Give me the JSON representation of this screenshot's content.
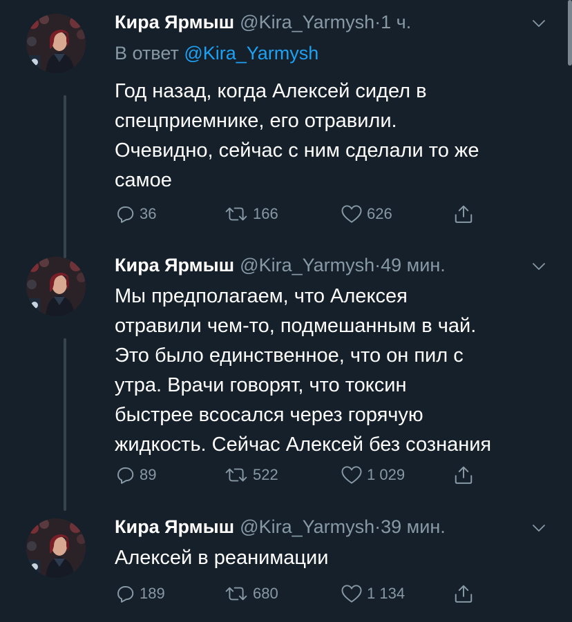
{
  "colors": {
    "background": "#15202b",
    "text": "#ffffff",
    "secondary": "#8899a6",
    "accent": "#1da1f2",
    "thread_line": "#38444d"
  },
  "icons": {
    "reply": "reply-icon",
    "retweet": "retweet-icon",
    "like": "heart-icon",
    "share": "share-icon",
    "menu": "chevron-down-icon"
  },
  "tweets": [
    {
      "name": "Кира Ярмыш",
      "handle": "@Kira_Yarmysh",
      "dot": "·",
      "time": "1 ч.",
      "reply_label": "В ответ",
      "reply_mention": "@Kira_Yarmysh",
      "text": "Год назад, когда Алексей сидел в\nспецприемнике, его отравили.\nОчевидно, сейчас с ним сделали то же\nсамое",
      "replies": "36",
      "retweets": "166",
      "likes": "626"
    },
    {
      "name": "Кира Ярмыш",
      "handle": "@Kira_Yarmysh",
      "dot": "·",
      "time": "49 мин.",
      "text": "Мы предполагаем, что Алексея\nотравили чем-то, подмешанным в чай.\nЭто было единственное, что он пил с\nутра. Врачи говорят, что токсин\nбыстрее всосался через горячую\nжидкость. Сейчас Алексей без сознания",
      "replies": "89",
      "retweets": "522",
      "likes": "1 029"
    },
    {
      "name": "Кира Ярмыш",
      "handle": "@Kira_Yarmysh",
      "dot": "·",
      "time": "39 мин.",
      "text": "Алексей в реанимации",
      "replies": "189",
      "retweets": "680",
      "likes": "1 134"
    }
  ]
}
